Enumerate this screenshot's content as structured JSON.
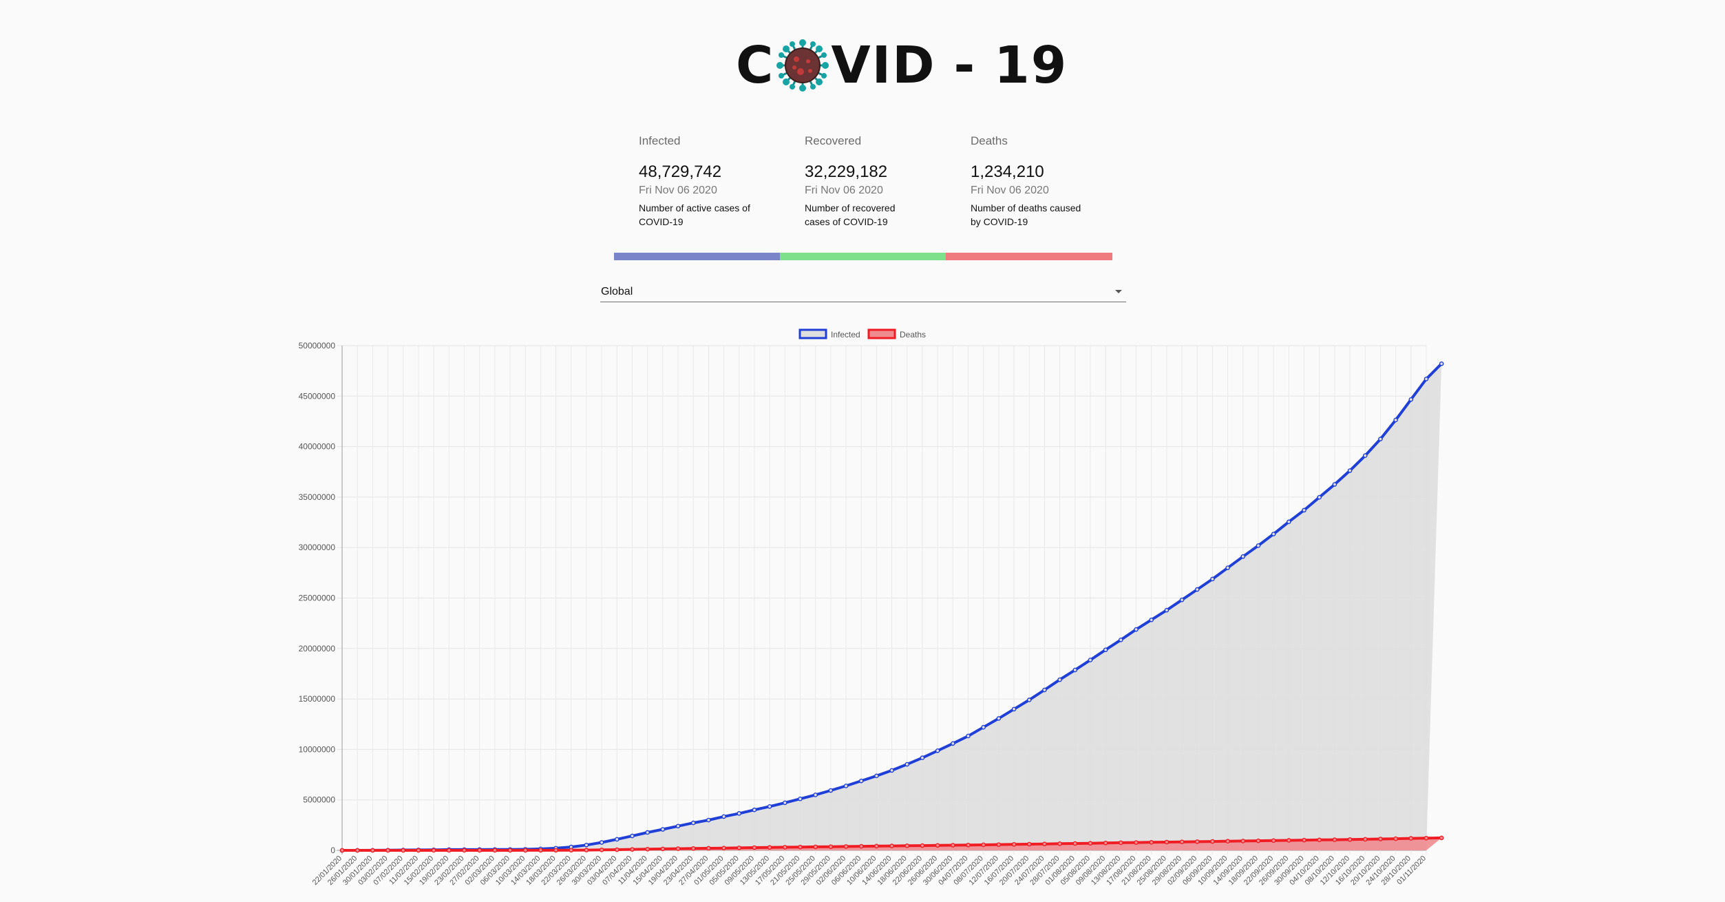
{
  "header": {
    "logo_text_left": "C",
    "logo_text_right": "VID",
    "logo_sep": "-",
    "logo_number": "19",
    "logo_virus_icon": "virus-icon"
  },
  "cards": [
    {
      "title": "Infected",
      "value": "48,729,742",
      "date": "Fri Nov 06 2020",
      "desc_line1": "Number of active cases of",
      "desc_line2": "COVID-19",
      "color": "#7a84c8"
    },
    {
      "title": "Recovered",
      "value": "32,229,182",
      "date": "Fri Nov 06 2020",
      "desc_line1": "Number of recovered",
      "desc_line2": "cases of COVID-19",
      "color": "#7fe08c"
    },
    {
      "title": "Deaths",
      "value": "1,234,210",
      "date": "Fri Nov 06 2020",
      "desc_line1": "Number of deaths caused",
      "desc_line2": "by COVID-19",
      "color": "#f07b7f"
    }
  ],
  "region_select": {
    "selected": "Global"
  },
  "chart_data": {
    "type": "line",
    "title": "",
    "xlabel": "",
    "ylabel": "",
    "ylim": [
      0,
      50000000
    ],
    "y_ticks": [
      0,
      5000000,
      10000000,
      15000000,
      20000000,
      25000000,
      30000000,
      35000000,
      40000000,
      45000000,
      50000000
    ],
    "grid": true,
    "legend": "top-center",
    "x_start": "22/01/2020",
    "x_end": "06/11/2020",
    "x_tick_labels": [
      "22/01/2020",
      "26/01/2020",
      "30/01/2020",
      "03/02/2020",
      "07/02/2020",
      "11/02/2020",
      "15/02/2020",
      "19/02/2020",
      "23/02/2020",
      "27/02/2020",
      "02/03/2020",
      "06/03/2020",
      "10/03/2020",
      "14/03/2020",
      "18/03/2020",
      "22/03/2020",
      "26/03/2020",
      "30/03/2020",
      "03/04/2020",
      "07/04/2020",
      "11/04/2020",
      "15/04/2020",
      "19/04/2020",
      "23/04/2020",
      "27/04/2020",
      "01/05/2020",
      "05/05/2020",
      "09/05/2020",
      "13/05/2020",
      "17/05/2020",
      "21/05/2020",
      "25/05/2020",
      "29/05/2020",
      "02/06/2020",
      "06/06/2020",
      "10/06/2020",
      "14/06/2020",
      "18/06/2020",
      "22/06/2020",
      "26/06/2020",
      "30/06/2020",
      "04/07/2020",
      "08/07/2020",
      "12/07/2020",
      "16/07/2020",
      "20/07/2020",
      "24/07/2020",
      "28/07/2020",
      "01/08/2020",
      "05/08/2020",
      "09/08/2020",
      "13/08/2020",
      "17/08/2020",
      "21/08/2020",
      "25/08/2020",
      "29/08/2020",
      "02/09/2020",
      "06/09/2020",
      "10/09/2020",
      "14/09/2020",
      "18/09/2020",
      "22/09/2020",
      "26/09/2020",
      "30/09/2020",
      "04/10/2020",
      "08/10/2020",
      "12/10/2020",
      "16/10/2020",
      "20/10/2020",
      "24/10/2020",
      "28/10/2020",
      "01/11/2020"
    ],
    "series": [
      {
        "name": "Infected",
        "color": "#1f3fd6",
        "fill": "#dedede",
        "values": [
          555,
          2000,
          8000,
          17000,
          31000,
          43000,
          51000,
          73000,
          76000,
          78000,
          82000,
          86000,
          102000,
          142000,
          214000,
          334000,
          528000,
          784000,
          1095000,
          1426000,
          1775000,
          2078000,
          2401000,
          2722000,
          3002000,
          3349000,
          3659000,
          4010000,
          4347000,
          4711000,
          5103000,
          5495000,
          5933000,
          6382000,
          6880000,
          7378000,
          7920000,
          8524000,
          9168000,
          9872000,
          10588000,
          11326000,
          12196000,
          13071000,
          13988000,
          14906000,
          15891000,
          16907000,
          17868000,
          18856000,
          19867000,
          20852000,
          21884000,
          22835000,
          23796000,
          24817000,
          25845000,
          26878000,
          27991000,
          29109000,
          30190000,
          31336000,
          32548000,
          33698000,
          34980000,
          36253000,
          37620000,
          39106000,
          40750000,
          42635000,
          44667000,
          46701000,
          48210000
        ]
      },
      {
        "name": "Deaths",
        "color": "#f01d24",
        "fill": "#ef8c90",
        "values": [
          17,
          56,
          170,
          425,
          721,
          1017,
          1600,
          2010,
          2460,
          2800,
          3000,
          3400,
          4200,
          5800,
          9300,
          16500,
          28000,
          45000,
          69000,
          93000,
          117000,
          140000,
          166000,
          188000,
          207000,
          227000,
          247000,
          272000,
          291000,
          311000,
          330000,
          348000,
          364000,
          384000,
          403000,
          420000,
          437000,
          455000,
          474000,
          491000,
          509000,
          528000,
          549000,
          572000,
          595000,
          614000,
          637000,
          663000,
          682000,
          705000,
          731000,
          754000,
          775000,
          795000,
          819000,
          839000,
          860000,
          881000,
          906000,
          926000,
          946000,
          969000,
          991000,
          1015000,
          1034000,
          1053000,
          1075000,
          1095000,
          1126000,
          1154000,
          1187000,
          1210000,
          1234210
        ]
      }
    ]
  }
}
